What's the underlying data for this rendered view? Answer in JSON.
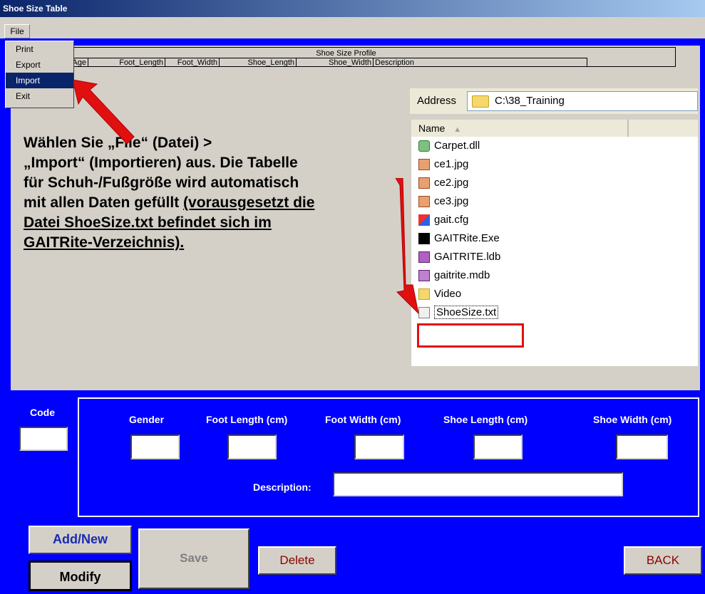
{
  "window": {
    "title": "Shoe Size Table"
  },
  "menu": {
    "file_label": "File",
    "items": [
      "Print",
      "Export",
      "Import",
      "Exit"
    ],
    "highlighted_index": 2
  },
  "grid": {
    "title": "Shoe Size Profile",
    "headers": [
      "ender_Age",
      "Foot_Length",
      "Foot_Width",
      "Shoe_Length",
      "Shoe_Width",
      "Description"
    ]
  },
  "explorer": {
    "address_label": "Address",
    "address_value": "C:\\38_Training",
    "column_name": "Name",
    "files": [
      "Carpet.dll",
      "ce1.jpg",
      "ce2.jpg",
      "ce3.jpg",
      "gait.cfg",
      "GAITRite.Exe",
      "GAITRITE.ldb",
      "gaitrite.mdb",
      "Video",
      "ShoeSize.txt"
    ],
    "highlighted_file": "ShoeSize.txt"
  },
  "instruction": {
    "line1": "Wählen Sie „File“ (Datei) >",
    "line2": "„Import“ (Importieren) aus. Die Tabelle",
    "line3": "für Schuh-/Fußgröße wird automatisch",
    "line4_plain": "mit allen Daten gefüllt ",
    "line4_underlined": "(vorausgesetzt die",
    "line5": "Datei ShoeSize.txt befindet sich im",
    "line6": "GAITRite-Verzeichnis)."
  },
  "form": {
    "code_label": "Code",
    "gender_label": "Gender",
    "foot_length_label": "Foot Length (cm)",
    "foot_width_label": "Foot Width (cm)",
    "shoe_length_label": "Shoe Length (cm)",
    "shoe_width_label": "Shoe Width (cm)",
    "description_label": "Description:"
  },
  "buttons": {
    "add_new": "Add/New",
    "modify": "Modify",
    "save": "Save",
    "delete": "Delete",
    "back": "BACK"
  },
  "colors": {
    "background": "#0000ff",
    "panel": "#d4d0c8",
    "arrow": "#e01010"
  }
}
